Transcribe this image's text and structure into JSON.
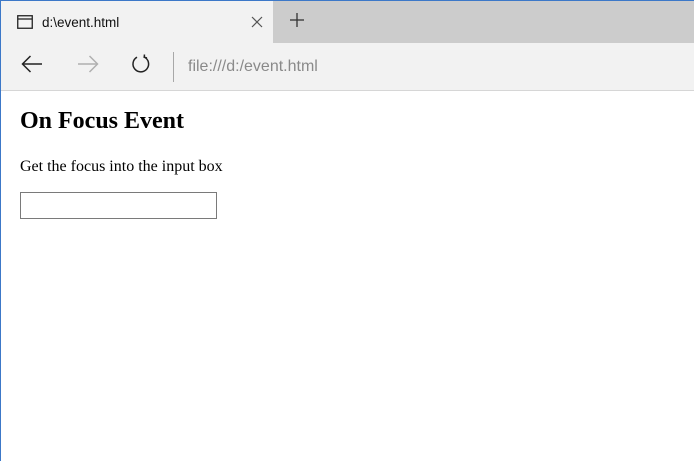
{
  "browser": {
    "tab": {
      "title": "d:\\event.html",
      "icon": "tab-page-icon",
      "close_icon": "close-icon"
    },
    "new_tab_icon": "plus-icon",
    "nav": {
      "back_icon": "arrow-left-icon",
      "forward_icon": "arrow-right-icon",
      "refresh_icon": "refresh-icon"
    },
    "address": "file:///d:/event.html"
  },
  "page": {
    "heading": "On Focus Event",
    "text": "Get the focus into the input box",
    "input": {
      "value": "",
      "placeholder": ""
    }
  },
  "colors": {
    "tabstrip": "#cccccc",
    "chrome": "#f2f2f2",
    "window_border": "#3c78c8",
    "address_text": "#8a8a8a"
  }
}
